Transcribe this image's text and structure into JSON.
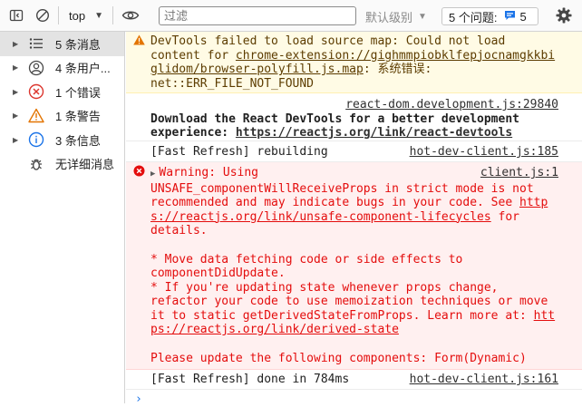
{
  "toolbar": {
    "context": "top",
    "filter_placeholder": "过滤",
    "levels_label": "默认级别",
    "issues_label": "5 个问题:",
    "issues_count": "5"
  },
  "sidebar": {
    "items": [
      {
        "label": "5 条消息"
      },
      {
        "label": "4 条用户..."
      },
      {
        "label": "1 个错误"
      },
      {
        "label": "1 条警告"
      },
      {
        "label": "3 条信息"
      },
      {
        "label": "无详细消息"
      }
    ]
  },
  "console": {
    "warning": {
      "line1": "DevTools failed to load source map: Could not load",
      "line2_prefix": "content for ",
      "url": "chrome-extension://gighmmpiobklfepjocnamgkkbiglidom/browser-polyfill.js.map",
      "url_part1": "chrome-extension://gighmmpiobklfepjocnamgkkbi",
      "url_part2": "glidom/browser-polyfill.js.map",
      "line3_suffix": ": 系统错误:",
      "line4": "net::ERR_FILE_NOT_FOUND"
    },
    "devtools_msg": {
      "source": "react-dom.development.js:29840",
      "line1": "Download the React DevTools for a better development",
      "line2_prefix": "experience: ",
      "link": "https://reactjs.org/link/react-devtools"
    },
    "refresh1": {
      "text": "[Fast Refresh] rebuilding",
      "source": "hot-dev-client.js:185"
    },
    "error": {
      "title": "Warning: Using",
      "source": "client.js:1",
      "l1": "UNSAFE_componentWillReceiveProps in strict mode is not",
      "l2": "recommended and may indicate bugs in your code. See http",
      "link1_part1": "http",
      "link1_part2": "s://reactjs.org/link/unsafe-component-lifecycles",
      "l3_suffix": " for",
      "l4": "details.",
      "b1a": "* Move data fetching code or side effects to",
      "b1b": "componentDidUpdate.",
      "b2a": "* If you're updating state whenever props change,",
      "b2b": "refactor your code to use memoization techniques or move",
      "b2c_prefix": "it to static getDerivedStateFromProps. Learn more at: ",
      "link2_part1": "htt",
      "link2_part2": "ps://reactjs.org/link/derived-state",
      "final": "Please update the following components: Form(Dynamic)"
    },
    "refresh2": {
      "text": "[Fast Refresh] done in 784ms",
      "source": "hot-dev-client.js:161"
    },
    "prompt": "›"
  }
}
